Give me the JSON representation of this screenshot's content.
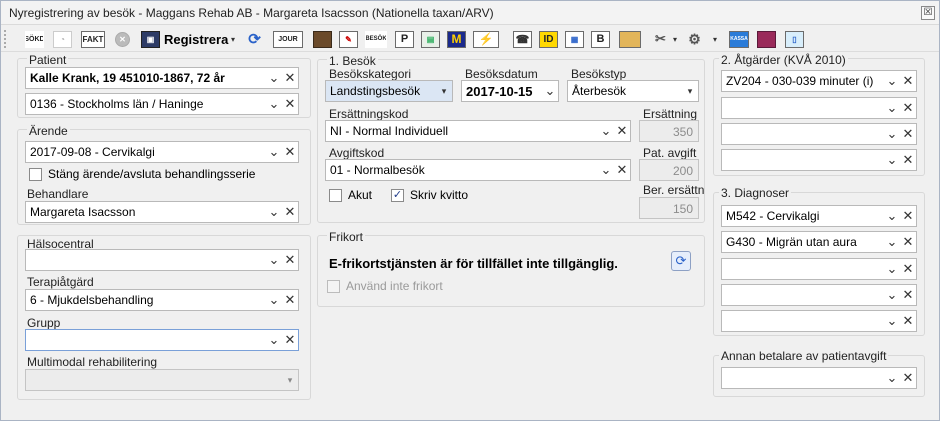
{
  "window": {
    "title": "Nyregistrering av besök  - Maggans Rehab AB - Margareta Isacsson (Nationella taxan/ARV)",
    "close": "☒"
  },
  "toolbar": {
    "register_label": "Registrera",
    "icons": [
      "search-patient-icon",
      "glasses-icon",
      "fakt-icon",
      "cancel-circle-icon",
      "save-icon",
      "refresh-icon",
      "journal-icon",
      "briefcase-icon",
      "edit-note-icon",
      "besok-icon",
      "print-p-icon",
      "note-pad-icon",
      "m-icon",
      "lightning-icon",
      "speech-icon",
      "id-card-icon",
      "card-reader-icon",
      "b-document-icon",
      "tape-icon",
      "calendar-tools-icon",
      "settings-icon",
      "kassa-icon",
      "book-icon",
      "phone-icon"
    ],
    "texts": {
      "sok": "SÖKD",
      "fakt": "FAKT",
      "journal": "JOUR",
      "besok": "BESÖK",
      "p": "P",
      "m": "M",
      "id": "ID",
      "b": "B",
      "kassa": "KASSA"
    }
  },
  "patient": {
    "label": "Patient",
    "name": "Kalle Krank, 19 451010-1867, 72 år",
    "region": "0136 - Stockholms län / Haninge"
  },
  "arende": {
    "label": "Ärende",
    "value": "2017-09-08 - Cervikalgi",
    "close_series": "Stäng ärende/avsluta behandlingsserie",
    "behandlare_label": "Behandlare",
    "behandlare": "Margareta Isacsson"
  },
  "lower_left": {
    "halsocentral_label": "Hälsocentral",
    "halsocentral": "",
    "terapi_label": "Terapiåtgärd",
    "terapi": "6 - Mjukdelsbehandling",
    "grupp_label": "Grupp",
    "grupp": "",
    "multimodal_label": "Multimodal rehabilitering",
    "multimodal": ""
  },
  "besok": {
    "section": "1. Besök",
    "kategori_label": "Besökskategori",
    "kategori": "Landstingsbesök",
    "datum_label": "Besöksdatum",
    "datum": "2017-10-15",
    "typ_label": "Besökstyp",
    "typ": "Återbesök",
    "ersattningskod_label": "Ersättningskod",
    "ersattningskod": "NI - Normal Individuell",
    "ersattning_label": "Ersättning",
    "ersattning": "350",
    "avgiftskod_label": "Avgiftskod",
    "avgiftskod": "01 - Normalbesök",
    "pat_avgift_label": "Pat. avgift",
    "pat_avgift": "200",
    "akut_label": "Akut",
    "akut": false,
    "kvitto_label": "Skriv kvitto",
    "kvitto": true,
    "ber_label": "Ber. ersättn",
    "ber": "150"
  },
  "frikort": {
    "section": "Frikort",
    "message": "E-frikortstjänsten är för tillfället inte tillgänglig.",
    "use_label": "Använd inte frikort"
  },
  "atgarder": {
    "section": "2. Åtgärder (KVÅ 2010)",
    "items": [
      "ZV204 - 030-039 minuter (i)",
      "",
      "",
      ""
    ]
  },
  "diagnoser": {
    "section": "3. Diagnoser",
    "items": [
      "M542 - Cervikalgi",
      "G430 - Migrän utan aura",
      "",
      "",
      ""
    ]
  },
  "annan": {
    "section": "Annan betalare av patientavgift",
    "value": ""
  },
  "glyphs": {
    "chev": "⌄",
    "x": "✕",
    "check": "✓",
    "refresh": "⟳",
    "arrow": "▾"
  }
}
